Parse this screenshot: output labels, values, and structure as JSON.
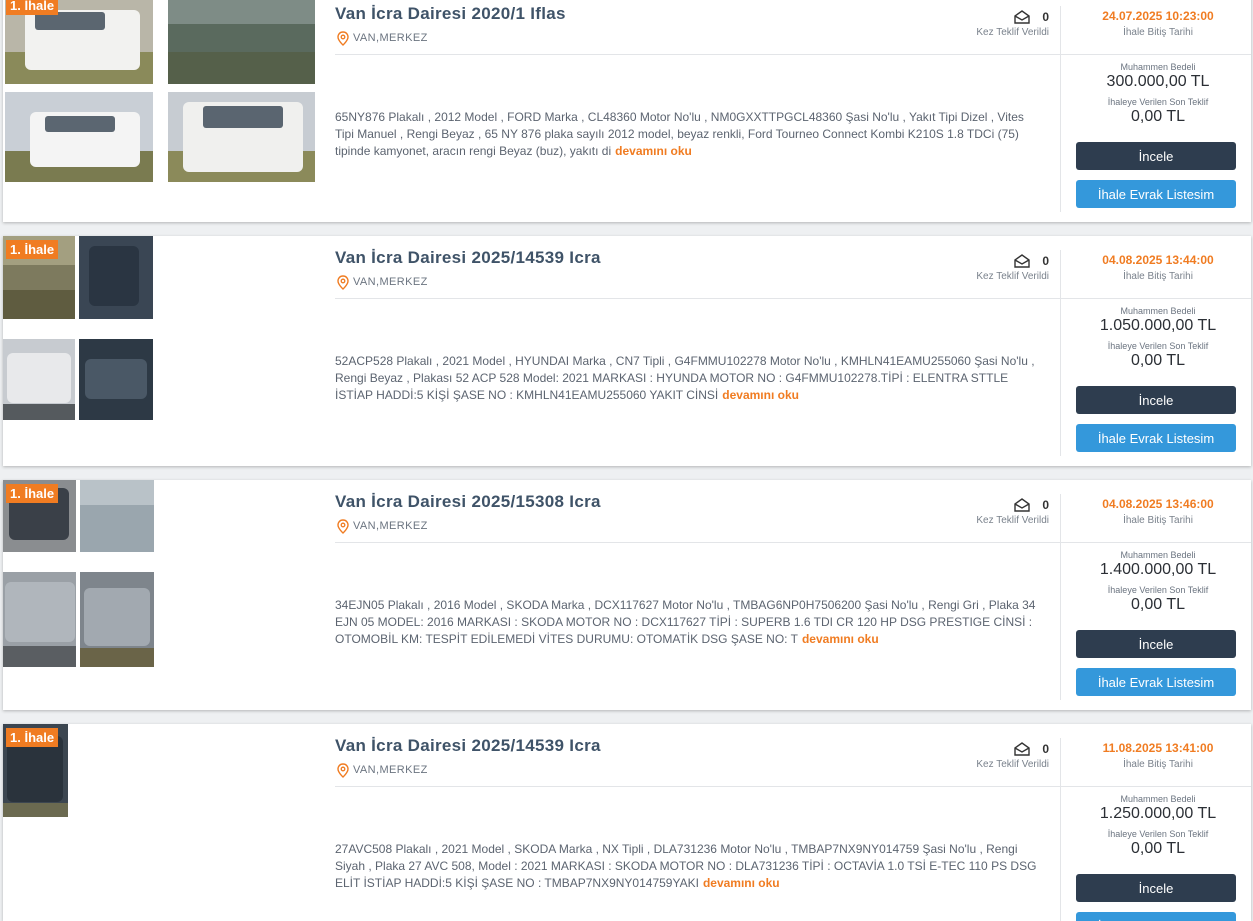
{
  "labels": {
    "badge": "1. İhale",
    "offers_label": "Kez Teklif Verildi",
    "end_label": "İhale Bitiş Tarihi",
    "estimate_label": "Muhammen Bedeli",
    "last_offer_label": "İhaleye Verilen Son Teklif",
    "read_more": "devamını oku",
    "inspect_button": "İncele",
    "documents_button": "İhale Evrak Listesim"
  },
  "colors": {
    "accent": "#f07c22",
    "dark_button": "#2e3d4f",
    "blue_button": "#3498db",
    "title": "#3f5368"
  },
  "listings": [
    {
      "title": "Van İcra Dairesi 2020/1 Iflas",
      "location": "VAN,MERKEZ",
      "offer_count": "0",
      "description": "65NY876 Plakalı , 2012 Model , FORD Marka , CL48360 Motor No'lu , NM0GXXTTPGCL48360 Şasi No'lu , Yakıt Tipi Dizel , Vites Tipi Manuel , Rengi Beyaz , 65 NY 876 plaka sayılı 2012 model, beyaz renkli, Ford Tourneo Connect Kombi K210S 1.8 TDCi (75) tipinde kamyonet, aracın rengi Beyaz (buz), yakıtı di",
      "end_date": "24.07.2025 10:23:00",
      "estimate": "300.000,00 TL",
      "last_offer": "0,00 TL"
    },
    {
      "title": "Van İcra Dairesi 2025/14539 Icra",
      "location": "VAN,MERKEZ",
      "offer_count": "0",
      "description": "52ACP528 Plakalı , 2021 Model , HYUNDAI Marka , CN7 Tipli , G4FMMU102278 Motor No'lu , KMHLN41EAMU255060 Şasi No'lu , Rengi Beyaz , Plakası 52 ACP 528 Model: 2021 MARKASI : HYUNDA MOTOR NO : G4FMMU102278.TİPİ : ELENTRA STTLE İSTİAP HADDİ:5 KİŞİ ŞASE NO : KMHLN41EAMU255060 YAKIT CİNSİ",
      "end_date": "04.08.2025 13:44:00",
      "estimate": "1.050.000,00 TL",
      "last_offer": "0,00 TL"
    },
    {
      "title": "Van İcra Dairesi 2025/15308 Icra",
      "location": "VAN,MERKEZ",
      "offer_count": "0",
      "description": "34EJN05 Plakalı , 2016 Model , SKODA Marka , DCX117627 Motor No'lu , TMBAG6NP0H7506200 Şasi No'lu , Rengi Gri , Plaka 34 EJN 05 MODEL: 2016 MARKASI : SKODA MOTOR NO : DCX117627 TİPİ : SUPERB 1.6 TDI CR 120 HP DSG PRESTIGE CİNSİ : OTOMOBİL KM: TESPİT EDİLEMEDİ VİTES DURUMU: OTOMATİK DSG ŞASE NO: T",
      "end_date": "04.08.2025 13:46:00",
      "estimate": "1.400.000,00 TL",
      "last_offer": "0,00 TL"
    },
    {
      "title": "Van İcra Dairesi 2025/14539 Icra",
      "location": "VAN,MERKEZ",
      "offer_count": "0",
      "description": "27AVC508 Plakalı , 2021 Model , SKODA Marka , NX Tipli , DLA731236 Motor No'lu , TMBAP7NX9NY014759 Şasi No'lu , Rengi Siyah , Plaka 27 AVC 508, Model : 2021 MARKASI : SKODA MOTOR NO : DLA731236 TİPİ : OCTAVİA 1.0 TSİ E-TEC 110 PS DSG ELİT İSTİAP HADDİ:5 KİŞİ ŞASE NO : TMBAP7NX9NY014759YAKI",
      "end_date": "11.08.2025 13:41:00",
      "estimate": "1.250.000,00 TL",
      "last_offer": "0,00 TL"
    }
  ]
}
